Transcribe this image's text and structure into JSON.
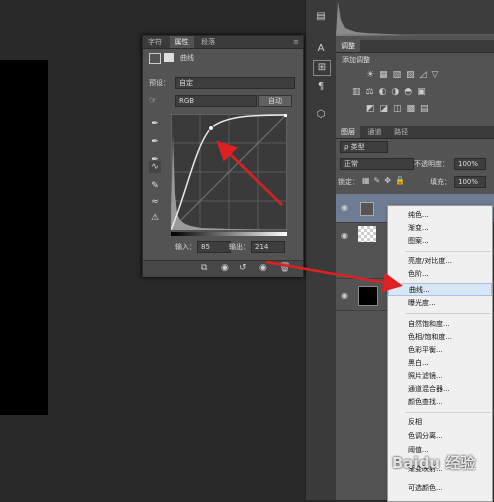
{
  "properties_panel": {
    "tabs": [
      "字符",
      "属性",
      "段落"
    ],
    "title": "曲线",
    "preset_label": "预设：",
    "preset_value": "自定",
    "channel_value": "RGB",
    "auto_button": "自动",
    "input_label": "输入：",
    "input_value": "85",
    "output_label": "输出：",
    "output_value": "214"
  },
  "adjustments_panel": {
    "tab": "调整",
    "title": "添加调整"
  },
  "layers_panel": {
    "tabs": [
      "图层",
      "通道",
      "路径"
    ],
    "filter_value": "ρ 类型",
    "blend_mode": "正常",
    "opacity_label": "不透明度：",
    "opacity_value": "100%",
    "lock_label": "锁定：",
    "fill_label": "填充：",
    "fill_value": "100%"
  },
  "context_menu": {
    "items": [
      "纯色...",
      "渐变...",
      "图案...",
      "亮度/对比度...",
      "色阶...",
      "曲线...",
      "曝光度...",
      "自然饱和度...",
      "色相/饱和度...",
      "色彩平衡...",
      "黑白...",
      "照片滤镜...",
      "通道混合器...",
      "颜色查找...",
      "反相",
      "色调分离...",
      "阈值...",
      "渐变映射...",
      "可选颜色..."
    ]
  },
  "watermark": "Baidu 经验",
  "colors": {
    "menu_bg": "#f0f0f0",
    "panel_bg": "#535353",
    "arrow": "#e02020"
  }
}
